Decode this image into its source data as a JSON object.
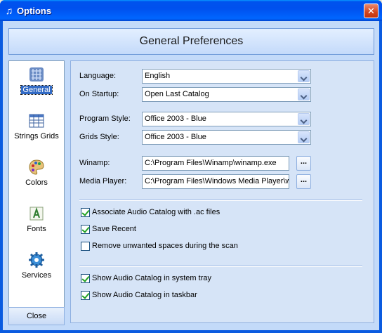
{
  "window": {
    "title": "Options",
    "close_glyph": "✕",
    "icon": "music-note-icon",
    "title_glyph": "♫"
  },
  "header": {
    "title": "General Preferences"
  },
  "sidebar": {
    "items": [
      {
        "label": "General",
        "icon": "general-settings-icon",
        "active": true
      },
      {
        "label": "Strings Grids",
        "icon": "grid-icon",
        "active": false
      },
      {
        "label": "Colors",
        "icon": "palette-icon",
        "active": false
      },
      {
        "label": "Fonts",
        "icon": "font-icon",
        "active": false
      },
      {
        "label": "Services",
        "icon": "gear-icon",
        "active": false
      }
    ],
    "close_label": "Close"
  },
  "form": {
    "language": {
      "label": "Language:",
      "value": "English"
    },
    "on_startup": {
      "label": "On Startup:",
      "value": "Open Last Catalog"
    },
    "program_style": {
      "label": "Program Style:",
      "value": "Office 2003 - Blue"
    },
    "grids_style": {
      "label": "Grids Style:",
      "value": "Office 2003 - Blue"
    },
    "winamp": {
      "label": "Winamp:",
      "value": "C:\\Program Files\\Winamp\\winamp.exe",
      "browse": "..."
    },
    "media_player": {
      "label": "Media Player:",
      "value": "C:\\Program Files\\Windows Media Player\\wmplayer.exe",
      "browse": "..."
    }
  },
  "checkboxes": [
    {
      "label": "Associate Audio Catalog with .ac files",
      "checked": true
    },
    {
      "label": "Save Recent",
      "checked": true
    },
    {
      "label": "Remove unwanted spaces during the scan",
      "checked": false
    },
    {
      "label": "Show Audio Catalog in system tray",
      "checked": true
    },
    {
      "label": "Show Audio Catalog in taskbar",
      "checked": true
    }
  ]
}
